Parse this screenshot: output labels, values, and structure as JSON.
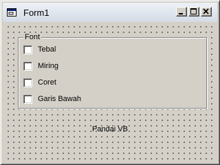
{
  "window": {
    "title": "Form1",
    "icon": "form-window-icon",
    "controls": [
      "minimize-icon",
      "maximize-icon",
      "close-icon"
    ]
  },
  "frame": {
    "label": "Font",
    "options": [
      {
        "label": "Tebal",
        "checked": false
      },
      {
        "label": "Miring",
        "checked": false
      },
      {
        "label": "Coret",
        "checked": false
      },
      {
        "label": "Garis Bawah",
        "checked": false
      }
    ]
  },
  "caption": "Pandai VB"
}
